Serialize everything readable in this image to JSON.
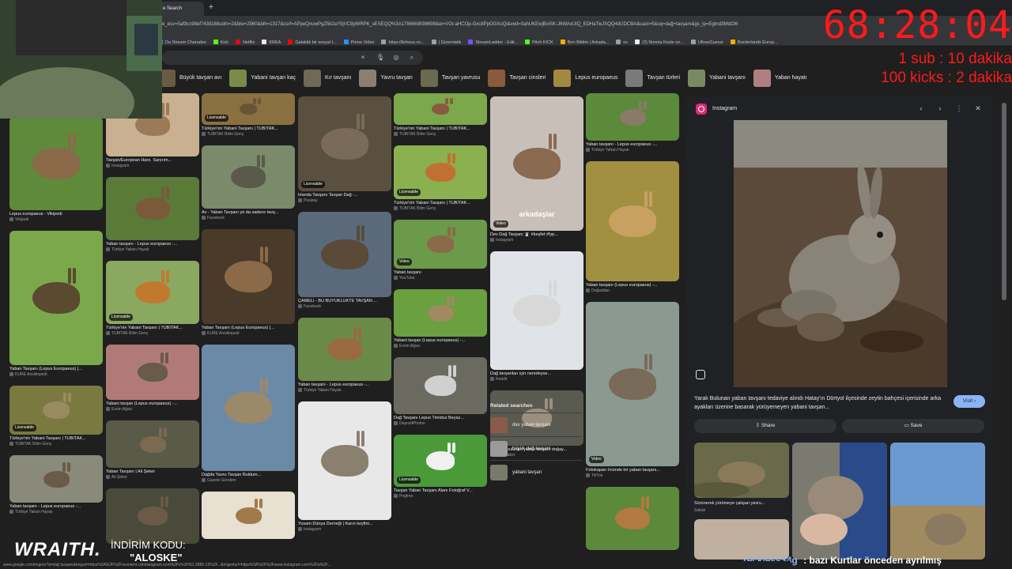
{
  "browser": {
    "tab_title": "e Search",
    "new_tab": "+",
    "url": "e_esv=5af3cc99ef7438188udm=2&biw=2560&bih=1317&csrf=APpeQnuwPgZ5k2aY5jVC9pWRP6_uESEQQ%3A1786669098698&ei=VGt-aHCOp-Gxc8PpOGXoQi&ved=0ahUKEwjBviSK-J6WAxUlQ_EDHaTwJSQQ4dUDCBA&uact=5&oq=dağ+tavşanı&gs_lp=Egtnd3Mtd2l6",
    "bookmarks": [
      {
        "label": "Da Stream Charades",
        "color": "#4285f4"
      },
      {
        "label": "Kick",
        "color": "#53fc18"
      },
      {
        "label": "Netflix",
        "color": "#e50914"
      },
      {
        "label": "KREA",
        "color": "#e8eaed"
      },
      {
        "label": "Galaktik bir sosyal t...",
        "color": "#ff0000"
      },
      {
        "label": "Prime Video",
        "color": "#1a98ff"
      },
      {
        "label": "https://lichess.co...",
        "color": "#9aa0a6"
      },
      {
        "label": "| Gizemlatik",
        "color": "#9aa0a6"
      },
      {
        "label": "StreamLadder - Edit...",
        "color": "#7c4dff"
      },
      {
        "label": "Pitch KICK",
        "color": "#53fc18"
      },
      {
        "label": "Ben Bildim | Arkada...",
        "color": "#f9ab00"
      },
      {
        "label": "ev",
        "color": "#9aa0a6"
      },
      {
        "label": "(3) Nimnia Kesle on...",
        "color": "#e8eaed"
      },
      {
        "label": "UltraxGuessr",
        "color": "#9aa0a6"
      },
      {
        "label": "Borderlands Europ...",
        "color": "#f9ab00"
      }
    ]
  },
  "search": {
    "clear_icon": "×",
    "mic_icon": "🎙",
    "lens_icon": "◎",
    "search_icon": "⌕"
  },
  "chips": [
    {
      "label": "Büyük tavşan avı",
      "color": "#6b5a44"
    },
    {
      "label": "Yabani tavşan kaç",
      "color": "#7a8a4a"
    },
    {
      "label": "Kır tavşanı",
      "color": "#6f6a55"
    },
    {
      "label": "Yavru tavşan",
      "color": "#8a8070"
    },
    {
      "label": "Tavşan yavrusu",
      "color": "#6a6a50"
    },
    {
      "label": "Tavşan cinsleri",
      "color": "#8a5a3a"
    },
    {
      "label": "Lepus europaeus",
      "color": "#a08a40"
    },
    {
      "label": "Tavşan türleri",
      "color": "#7a7a7a"
    },
    {
      "label": "Yabani tavşanı",
      "color": "#7a8a60"
    },
    {
      "label": "Yaban hayatı",
      "color": "#b08080"
    }
  ],
  "grid": {
    "columns": [
      [
        {
          "caption": "Lepus europaeus - Vikipedi",
          "source": "Vikipedi",
          "badge": "",
          "bg": "#5e8a3a",
          "fur": "#8a6a48"
        },
        {
          "caption": "Yaban Tavşanı (Lepus Europaeus) |...",
          "source": "KURE Ansiklopedi",
          "badge": "",
          "bg": "#7aa84a",
          "fur": "#5a4a30"
        },
        {
          "caption": "Türkiye'nin Yabani Tavşanı | TÜBİTAK...",
          "source": "TÜBİTAK Bilim Genç",
          "badge": "Licensable",
          "bg": "#7a7a40",
          "fur": "#9a8a60"
        },
        {
          "caption": "Yaban tavşanı - Lepus europaeus -...",
          "source": "Türkiye Yaban Hayatı",
          "badge": "",
          "bg": "#8a8a7a",
          "fur": "#6a5a48"
        }
      ],
      [
        {
          "caption": "Tavşan/European Hare. Sanırım...",
          "source": "Instagram",
          "badge": "",
          "bg": "#c8b090",
          "fur": "#9a7a58"
        },
        {
          "caption": "Yaban tavşanı - Lepus europaeus -...",
          "source": "Türkiye Yaban Hayatı",
          "badge": "",
          "bg": "#5a7a3a",
          "fur": "#7a5a38"
        },
        {
          "caption": "Türkiye'nin Yabani Tavşanı | TÜBİTAK...",
          "source": "TÜBİTAK Bilim Genç",
          "badge": "Licensable",
          "bg": "#8aa860",
          "fur": "#c07a30"
        },
        {
          "caption": "Yabani tavşan (Lepus europaeus) -...",
          "source": "Evrim Ağacı",
          "badge": "",
          "bg": "#b07a78",
          "fur": "#6a5a4a"
        },
        {
          "caption": "Yaban Tavşanı | Ali Şeker",
          "source": "Ali Şeker",
          "badge": "",
          "bg": "#5a5a48",
          "fur": "#7a6a50"
        },
        {
          "caption": "",
          "source": "",
          "badge": "",
          "bg": "#4a4a3a",
          "fur": "#6a5a48"
        }
      ],
      [
        {
          "caption": "Türkiye'nin Yabani Tavşanı | TÜBİTAK...",
          "source": "TÜBİTAK Bilim Genç",
          "badge": "Licensable",
          "bg": "#8a7040",
          "fur": "#6a5438"
        },
        {
          "caption": "Av - Yaban Tavşanı ye da sadece tavş...",
          "source": "Facebook",
          "badge": "",
          "bg": "#7a8a6a",
          "fur": "#5a5a4a"
        },
        {
          "caption": "Yaban Tavşanı (Lepus Europaeus) |...",
          "source": "KURE Ansiklopedi",
          "badge": "",
          "bg": "#4a3a2a",
          "fur": "#8a6a48"
        },
        {
          "caption": "Dağda Yavru Tavşan Buldum...",
          "source": "Gazete Gündem",
          "badge": "",
          "bg": "#6a8aa8",
          "fur": "#9a8a6a"
        },
        {
          "caption": "",
          "source": "",
          "badge": "",
          "bg": "#e8e0d0",
          "fur": "#a07a48"
        }
      ],
      [
        {
          "caption": "Irlanda Tavşanı Tavşan Dağ -...",
          "source": "Pixabay",
          "badge": "Licensable",
          "bg": "#5a5040",
          "fur": "#7a6a58"
        },
        {
          "caption": "ÇAMELİ - BU BÜYÜKLÜKTE TAVŞAN ...",
          "source": "Facebook",
          "badge": "",
          "bg": "#5a6a7a",
          "fur": "#5a4a38"
        },
        {
          "caption": "Yaban tavşanı - Lepus europaeus -...",
          "source": "Türkiye Yaban Hayatı",
          "badge": "",
          "bg": "#6a8a4a",
          "fur": "#9a6a40"
        },
        {
          "caption": "Yuvam Dünya Derneği | Karın keyfini...",
          "source": "Instagram",
          "badge": "",
          "bg": "#e8e8e8",
          "fur": "#8a8070"
        }
      ],
      [
        {
          "caption": "Türkiye'nin Yabani Tavşanı | TÜBİTAK...",
          "source": "TÜBİTAK Bilim Genç",
          "badge": "",
          "bg": "#7aa84a",
          "fur": "#8a5a40"
        },
        {
          "caption": "Türkiye'nin Yabani Tavşanı | TÜBİTAK...",
          "source": "TÜBİTAK Bilim Genç",
          "badge": "Licensable",
          "bg": "#8ab050",
          "fur": "#c07030"
        },
        {
          "caption": "Yaban tavşanı",
          "source": "YouTube",
          "badge": "Video",
          "bg": "#6a9a4a",
          "fur": "#8a6a48"
        },
        {
          "caption": "Yabani tavşan (Lepus europaeus) -...",
          "source": "Evrim Ağacı",
          "badge": "",
          "bg": "#6aa040",
          "fur": "#a08a60"
        },
        {
          "caption": "Dağ Tavşanı Lepus Timidus Beyaz...",
          "source": "DepositPhotos",
          "badge": "",
          "bg": "#6a6a60",
          "fur": "#d0d0d0"
        },
        {
          "caption": "Tavşan Yaban Tavşanı Alanı Fotoğraf V...",
          "source": "Pngtree",
          "badge": "Licensable",
          "bg": "#4a9a3a",
          "fur": "#f0f0f0"
        }
      ],
      [
        {
          "caption": "Dev Dağ Tavşanı 🐰 #keşfet #fyp...",
          "source": "Instagram",
          "badge": "Video",
          "bg": "#c8c0b8",
          "fur": "#8a6a50"
        },
        {
          "caption": "Dağ tavşanları için neredeyse...",
          "source": "Reddit",
          "badge": "",
          "bg": "#e0e4e8",
          "fur": "#d8d8d8"
        },
        {
          "caption": "Ordu'da bulunan yaban tavşanı doğay...",
          "source": "TRT Haber",
          "badge": "",
          "bg": "#5a5a50",
          "fur": "#9a9080"
        }
      ],
      [
        {
          "caption": "Yaban tavşanı - Lepus europaeus -...",
          "source": "Türkiye Yaban Hayatı",
          "badge": "",
          "bg": "#5a8a3a",
          "fur": "#8a7a68"
        },
        {
          "caption": "Yaban tavşanı (Lepus europaeus) -...",
          "source": "Doğaddan",
          "badge": "",
          "bg": "#a09040",
          "fur": "#c8a060"
        },
        {
          "caption": "Fotokapan önünde bir yaban tavşanı...",
          "source": "TikTok",
          "badge": "Video",
          "bg": "#8a9a90",
          "fur": "#7a6a5a"
        },
        {
          "caption": "",
          "source": "",
          "badge": "",
          "bg": "#5a8a3a",
          "fur": "#b07a40"
        }
      ]
    ]
  },
  "overlay_text": "arkadaşlar",
  "related_searches": {
    "title": "Related searches",
    "items": [
      {
        "label": "dev yaban tavşanı",
        "color": "#8a5a4a"
      },
      {
        "label": "büyük dağ tavşanı",
        "color": "#9a9a9a"
      },
      {
        "label": "yabani tavşan",
        "color": "#7a7a6a"
      }
    ]
  },
  "panel": {
    "source": "Instagram",
    "prev_icon": "‹",
    "next_icon": "›",
    "more_icon": "⋮",
    "close_icon": "✕",
    "title": "Yaralı Bulunan yaban tavşanı tedaviye alındı Hatay'ın Dörtyol ilçesinde zeytin bahçesi içerisinde arka ayakları üzerine basarak yürüyemeyen yabani tavşan...",
    "visit": "Visit ›",
    "share": "⇪ Share",
    "save": "▭ Save",
    "related_caption": "Sürünerek yürümeye çalışan yavru...",
    "related_source": "Sabah"
  },
  "stream": {
    "timer": "68:28:04",
    "goal1": "1 sub : 10 dakika",
    "goal2": "100 kicks : 2 dakika",
    "sponsor_brand": "WRAITH.",
    "sponsor_line1": "İNDİRİM KODU:",
    "sponsor_line2": "\"ALOSKE\"",
    "chat_user": "reckless34g",
    "chat_message": ": bazı Kurtlar önceden ayrılmış"
  },
  "status_url": "www.google.com/imgres?q=dağ tavşanı&imgurl=https%3A%2F%2Fscontent.cdninstagram.com%2Fv%2Ft51.2885-15%2F...&imgrefurl=https%3A%2F%2Fwww.instagram.com%2Fp%2F..."
}
